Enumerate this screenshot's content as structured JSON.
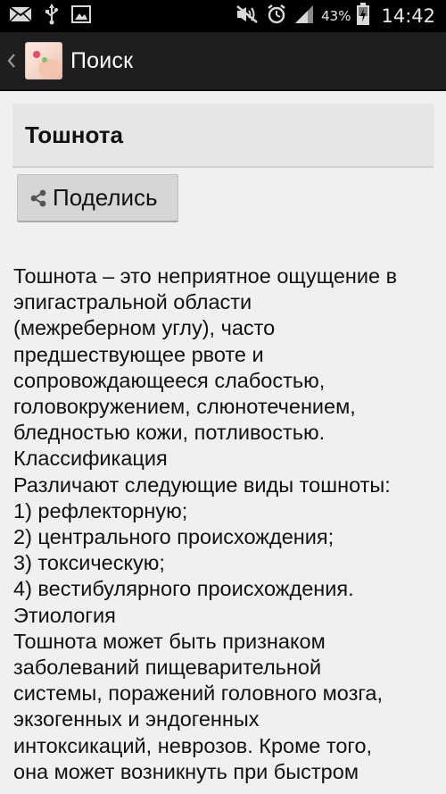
{
  "status_bar": {
    "icons": [
      "email-icon",
      "usb-icon",
      "image-icon",
      "mute-icon",
      "alarm-icon",
      "signal-icon",
      "battery-charging-icon"
    ],
    "battery": "43%",
    "time": "14:42"
  },
  "action_bar": {
    "title": "Поиск"
  },
  "article": {
    "title": "Тошнота",
    "share_label": "Поделись",
    "lines": [
      "Тошнота – это неприятное ощущение в",
      "эпигастральной области",
      "(межреберном углу), часто",
      "предшествующее рвоте и",
      "сопровождающееся слабостью,",
      "головокружением, слюнотечением,",
      "бледностью кожи, потливостью.",
      "Классификация",
      "Различают следующие виды тошноты:",
      "1) рефлекторную;",
      "2) центрального происхождения;",
      "3) токсическую;",
      "4) вестибулярного происхождения.",
      "Этиология",
      "Тошнота может быть признаком",
      "заболеваний пищеварительной",
      "системы, поражений головного мозга,",
      "экзогенных и эндогенных",
      "интоксикаций, неврозов. Кроме того,",
      "она может возникнуть при быстром"
    ]
  }
}
